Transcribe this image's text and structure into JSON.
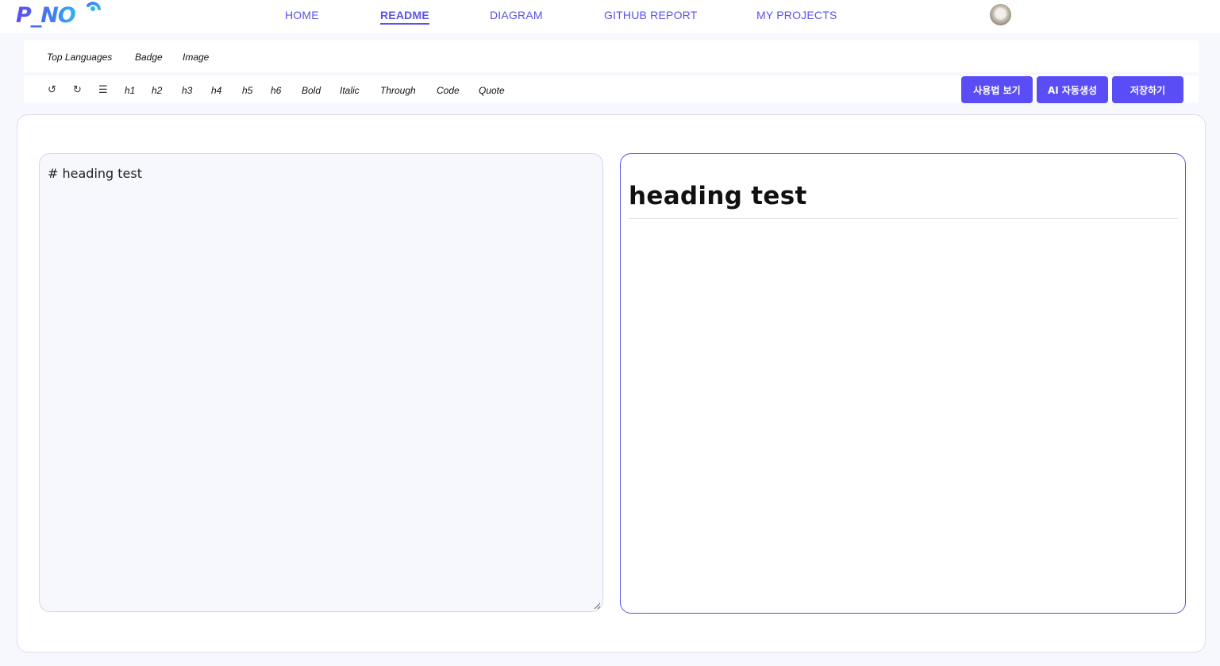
{
  "brand": {
    "logo_text": "P_NO"
  },
  "nav": {
    "items": [
      {
        "label": "HOME"
      },
      {
        "label": "README",
        "active": true
      },
      {
        "label": "DIAGRAM"
      },
      {
        "label": "GITHUB REPORT"
      },
      {
        "label": "MY PROJECTS"
      }
    ],
    "avatar_icon": "user-avatar"
  },
  "template_bar": {
    "items": [
      {
        "label": "Top Languages"
      },
      {
        "label": "Badge"
      },
      {
        "label": "Image"
      }
    ]
  },
  "format_bar": {
    "undo_symbol": "↺",
    "redo_symbol": "↻",
    "list_symbol": "☰",
    "items": [
      {
        "label": "h1"
      },
      {
        "label": "h2"
      },
      {
        "label": "h3"
      },
      {
        "label": "h4"
      },
      {
        "label": "h5"
      },
      {
        "label": "h6"
      },
      {
        "label": "Bold"
      },
      {
        "label": "Italic"
      },
      {
        "label": "Through"
      },
      {
        "label": "Code"
      },
      {
        "label": "Quote"
      }
    ],
    "actions": [
      {
        "label": "사용법 보기"
      },
      {
        "label": "AI 자동생성"
      },
      {
        "label": "저장하기"
      }
    ]
  },
  "editor": {
    "value": "# heading test"
  },
  "preview": {
    "heading": "heading test"
  },
  "colors": {
    "accent": "#5b4df5",
    "nav_text": "#5b52e8",
    "page_bg": "#f7f8fd",
    "editor_bg": "#f7f8fd",
    "preview_border": "#5b52e8"
  }
}
